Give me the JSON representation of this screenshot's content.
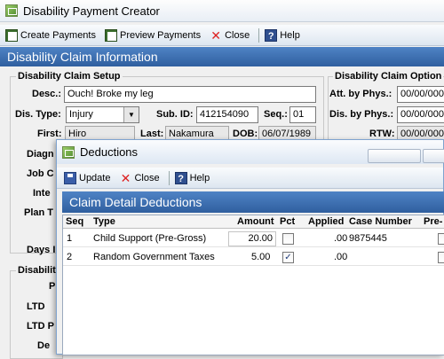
{
  "window": {
    "title": "Disability Payment Creator"
  },
  "toolbar": {
    "create_label": "Create Payments",
    "preview_label": "Preview Payments",
    "close_label": "Close",
    "help_label": "Help"
  },
  "main_header": "Disability Claim Information",
  "setup": {
    "title": "Disability Claim Setup",
    "desc_label": "Desc.:",
    "desc_value": "Ouch! Broke my leg",
    "dis_type_label": "Dis. Type:",
    "dis_type_value": "Injury",
    "sub_id_label": "Sub. ID:",
    "sub_id_value": "412154090",
    "seq_label": "Seq.:",
    "seq_value": "01",
    "first_label": "First:",
    "first_value": "Hiro",
    "last_label": "Last:",
    "last_value": "Nakamura",
    "dob_label": "DOB:",
    "dob_value": "06/07/1989",
    "partial_labels": [
      "Diagn",
      "Job C",
      "Inte",
      "Plan T",
      "Days I"
    ]
  },
  "options": {
    "title": "Disability Claim Option",
    "att_phys_label": "Att. by Phys.:",
    "att_phys_value": "00/00/0000",
    "dis_phys_label": "Dis. by Phys.:",
    "dis_phys_value": "00/00/0000",
    "rtw_label": "RTW:",
    "rtw_value": "00/00/0000"
  },
  "lower_group": {
    "title": "Disabilit",
    "partial_labels": [
      "P",
      "LTD",
      "LTD P",
      "De"
    ]
  },
  "deductions_dialog": {
    "title": "Deductions",
    "update_label": "Update",
    "close_label": "Close",
    "help_label": "Help",
    "header": "Claim Detail Deductions",
    "columns": [
      "Seq",
      "Type",
      "Amount",
      "Pct",
      "Applied",
      "Case Number",
      "Pre-"
    ],
    "rows": [
      {
        "seq": "1",
        "type": "Child Support (Pre-Gross)",
        "amount": "20.00",
        "pct": false,
        "applied": ".00",
        "case_number": "9875445"
      },
      {
        "seq": "2",
        "type": "Random Government Taxes",
        "amount": "5.00",
        "pct": true,
        "applied": ".00",
        "case_number": ""
      }
    ]
  }
}
